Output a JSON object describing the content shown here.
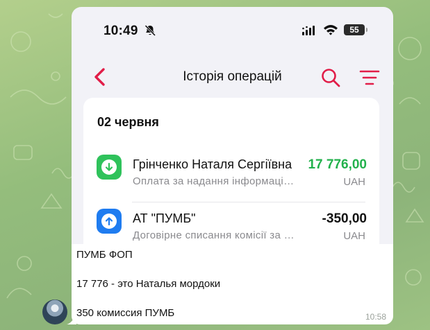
{
  "colors": {
    "accent": "#e11d48",
    "income": "#22b14c",
    "income_icon_bg": "#2fc25b",
    "expense_icon_bg": "#1f7cf0",
    "text": "#111111",
    "muted": "#8a8a8e"
  },
  "status_bar": {
    "time": "10:49",
    "bell_icon": "bell-slash-icon",
    "signal_icon": "cellular-signal-icon",
    "wifi_icon": "wifi-icon",
    "battery": "55"
  },
  "nav": {
    "back_icon": "chevron-left-icon",
    "title": "Історія операцій",
    "search_icon": "search-icon",
    "filter_icon": "filter-icon"
  },
  "history": {
    "date": "02 червня",
    "transactions": [
      {
        "icon": "arrow-down-icon",
        "name": "Грінченко Наталя Сергіївна",
        "description": "Оплата за надання інформаційних послуг",
        "amount": "17 776,00",
        "currency": "UAH",
        "type": "income"
      },
      {
        "icon": "arrow-up-icon",
        "name": "АТ \"ПУМБ\"",
        "description": "Договірне списання комісії за обслуговування",
        "amount": "-350,00",
        "currency": "UAH",
        "type": "expense"
      }
    ]
  },
  "message": {
    "lines": [
      "ПУМБ ФОП",
      "17 776 - это Наталья мордоки",
      "350 комиссия ПУМБ"
    ],
    "time": "10:58",
    "avatar_icon": "avatar"
  }
}
